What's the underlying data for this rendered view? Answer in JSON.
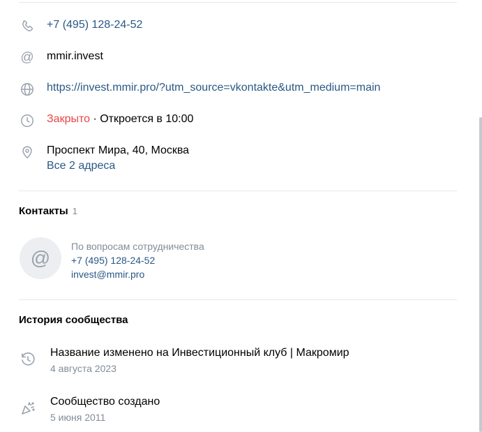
{
  "info": {
    "phone": "+7 (495) 128-24-52",
    "username": "mmir.invest",
    "website": "https://invest.mmir.pro/?utm_source=vkontakte&utm_medium=main",
    "hours_status": "Закрыто",
    "hours_separator": " · ",
    "hours_next": "Откроется в 10:00",
    "address": "Проспект Мира, 40, Москва",
    "all_addresses": "Все 2 адреса"
  },
  "contacts": {
    "title": "Контакты",
    "count": "1",
    "items": [
      {
        "description": "По вопросам сотрудничества",
        "phone": "+7 (495) 128-24-52",
        "email": "invest@mmir.pro"
      }
    ]
  },
  "history": {
    "title": "История сообщества",
    "items": [
      {
        "title": "Название изменено на Инвестиционный клуб | Макромир",
        "date": "4 августа 2023"
      },
      {
        "title": "Сообщество создано",
        "date": "5 июня 2011"
      }
    ]
  },
  "colors": {
    "link": "#2a5885",
    "closed": "#e64646",
    "secondary": "#818c99",
    "icon": "#99a2ad"
  }
}
